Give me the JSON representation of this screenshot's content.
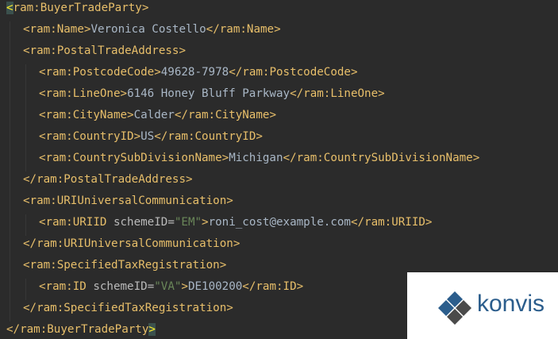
{
  "colors": {
    "background": "#2b2b2b",
    "tag": "#e8bf6a",
    "text": "#a9b7c6",
    "attribute": "#bababa",
    "attribute_value": "#6a8759",
    "bracket_highlight": "#3b514d",
    "logo_blue": "#2b5d8c",
    "logo_dark": "#4a4a4a"
  },
  "lines": [
    {
      "indent": 0,
      "open": "ram:BuyerTradeParty",
      "highlight_open_bracket": true
    },
    {
      "indent": 1,
      "open": "ram:Name",
      "text": "Veronica Costello",
      "close": "ram:Name"
    },
    {
      "indent": 1,
      "open": "ram:PostalTradeAddress"
    },
    {
      "indent": 2,
      "open": "ram:PostcodeCode",
      "text": "49628-7978",
      "close": "ram:PostcodeCode"
    },
    {
      "indent": 2,
      "open": "ram:LineOne",
      "text": "6146 Honey Bluff Parkway",
      "close": "ram:LineOne"
    },
    {
      "indent": 2,
      "open": "ram:CityName",
      "text": "Calder",
      "close": "ram:CityName"
    },
    {
      "indent": 2,
      "open": "ram:CountryID",
      "text": "US",
      "close": "ram:CountryID"
    },
    {
      "indent": 2,
      "open": "ram:CountrySubDivisionName",
      "text": "Michigan",
      "close": "ram:CountrySubDivisionName"
    },
    {
      "indent": 1,
      "closeonly": "ram:PostalTradeAddress"
    },
    {
      "indent": 1,
      "open": "ram:URIUniversalCommunication"
    },
    {
      "indent": 2,
      "open": "ram:URIID",
      "attr": "schemeID",
      "attrval": "\"EM\"",
      "text": "roni_cost@example.com",
      "close": "ram:URIID"
    },
    {
      "indent": 1,
      "closeonly": "ram:URIUniversalCommunication"
    },
    {
      "indent": 1,
      "open": "ram:SpecifiedTaxRegistration"
    },
    {
      "indent": 2,
      "open": "ram:ID",
      "attr": "schemeID",
      "attrval": "\"VA\"",
      "text": "DE100200",
      "close": "ram:ID"
    },
    {
      "indent": 1,
      "closeonly": "ram:SpecifiedTaxRegistration"
    },
    {
      "indent": 0,
      "closeonly": "ram:BuyerTradeParty",
      "highlight_close_bracket": true
    }
  ],
  "logo": {
    "text": "konvis",
    "icon": "konvis-diamond-logo-icon"
  }
}
